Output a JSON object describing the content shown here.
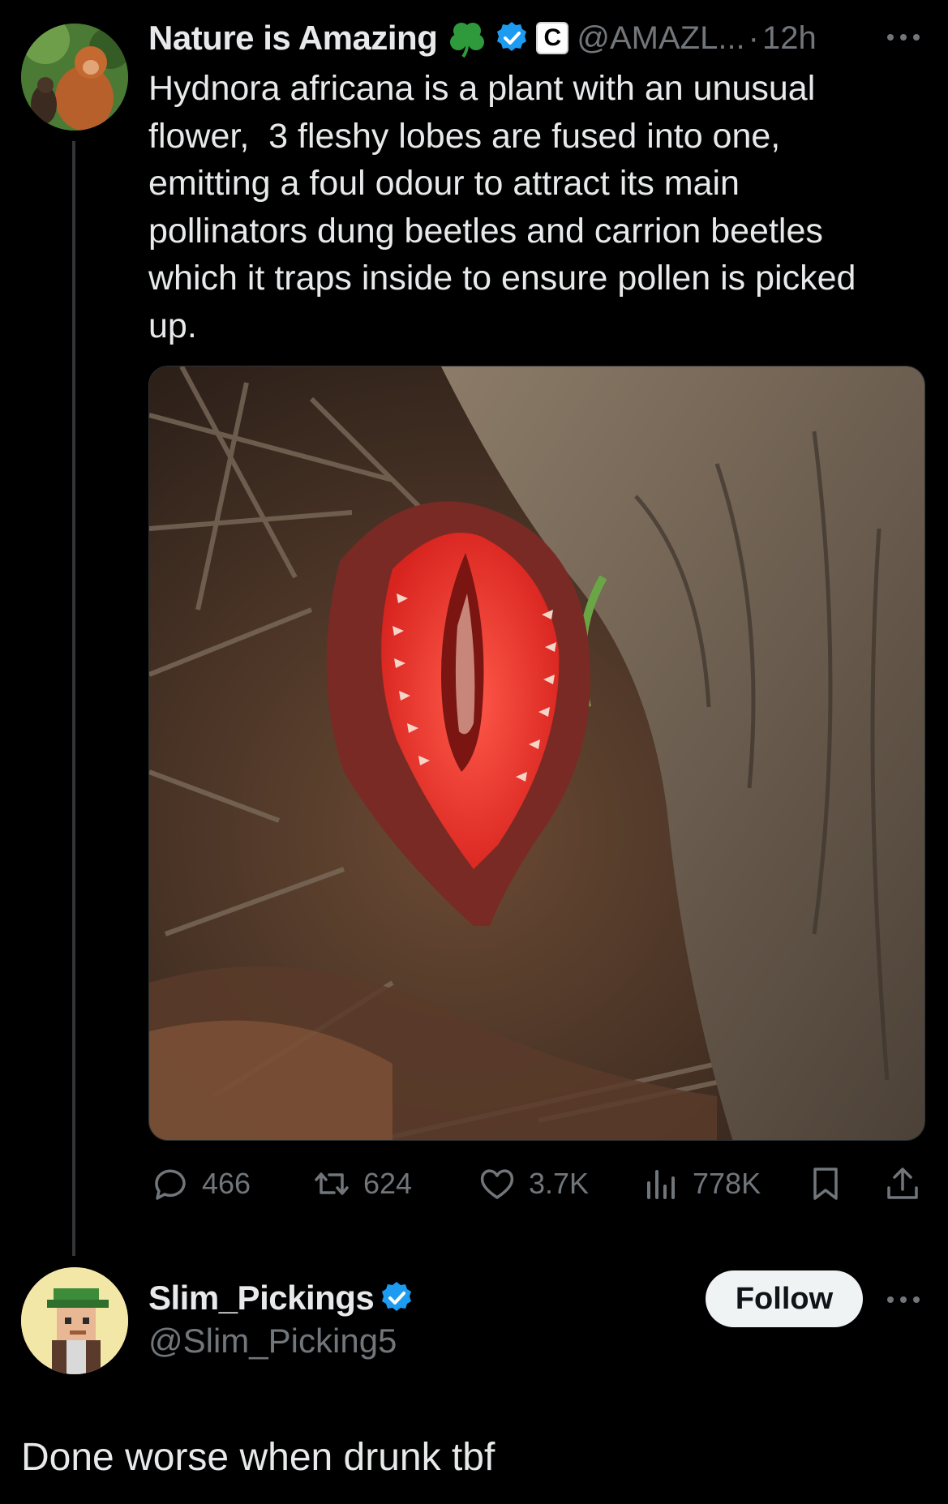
{
  "tweet": {
    "author_name": "Nature is Amazing",
    "author_handle": "@AMAZL...",
    "separator": "·",
    "time": "12h",
    "text": "Hydnora africana is a plant with an unusual\nflower,  3 fleshy lobes are fused into one,\nemitting a foul odour to attract its main\npollinators dung beetles and carrion beetles\nwhich it traps inside to ensure pollen is picked\nup.",
    "badge_letter": "C",
    "stats": {
      "replies": "466",
      "reposts": "624",
      "likes": "3.7K",
      "views": "778K"
    },
    "icons": [
      "clover-icon",
      "verified-icon",
      "more-icon",
      "reply-icon",
      "repost-icon",
      "like-icon",
      "views-icon",
      "bookmark-icon",
      "share-icon"
    ]
  },
  "reply": {
    "author_name": "Slim_Pickings",
    "author_handle": "@Slim_Picking5",
    "follow_label": "Follow",
    "text": "Done worse when drunk tbf"
  },
  "colors": {
    "background": "#000000",
    "text": "#e7e9ea",
    "muted": "#71767b",
    "verified": "#1d9bf0",
    "clover": "#2f9a3c",
    "flower_red": "#e0302a"
  }
}
